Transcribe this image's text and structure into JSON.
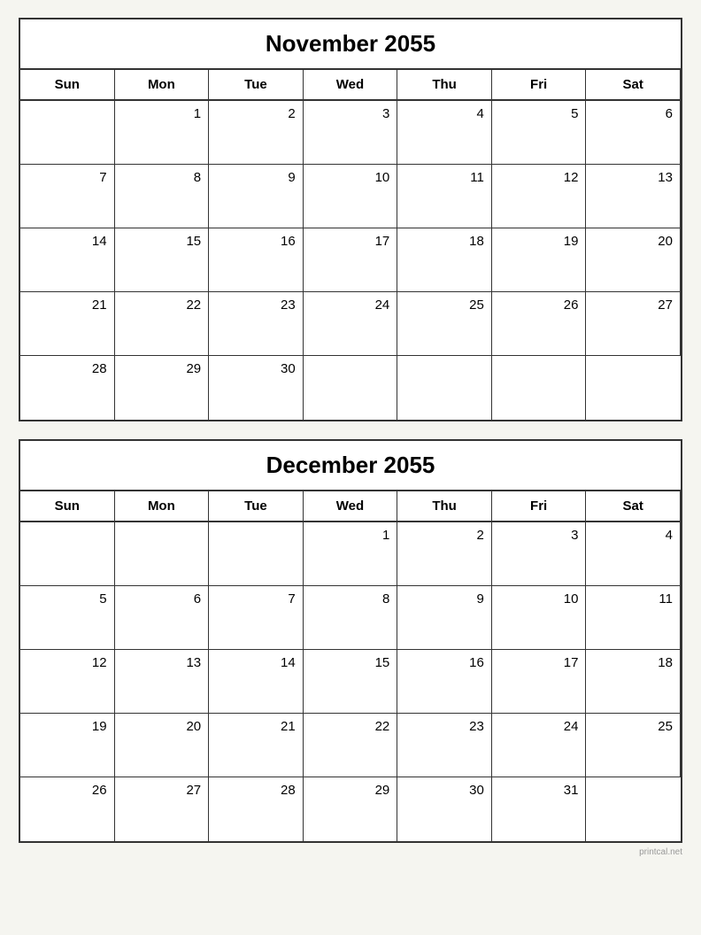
{
  "november": {
    "title": "November 2055",
    "headers": [
      "Sun",
      "Mon",
      "Tue",
      "Wed",
      "Thu",
      "Fri",
      "Sat"
    ],
    "weeks": [
      [
        {
          "day": "",
          "empty": true
        },
        {
          "day": "1"
        },
        {
          "day": "2"
        },
        {
          "day": "3"
        },
        {
          "day": "4"
        },
        {
          "day": "5"
        },
        {
          "day": "6"
        }
      ],
      [
        {
          "day": "7"
        },
        {
          "day": "8"
        },
        {
          "day": "9"
        },
        {
          "day": "10"
        },
        {
          "day": "11"
        },
        {
          "day": "12"
        },
        {
          "day": "13"
        }
      ],
      [
        {
          "day": "14"
        },
        {
          "day": "15"
        },
        {
          "day": "16"
        },
        {
          "day": "17"
        },
        {
          "day": "18"
        },
        {
          "day": "19"
        },
        {
          "day": "20"
        }
      ],
      [
        {
          "day": "21"
        },
        {
          "day": "22"
        },
        {
          "day": "23"
        },
        {
          "day": "24"
        },
        {
          "day": "25"
        },
        {
          "day": "26"
        },
        {
          "day": "27"
        }
      ],
      [
        {
          "day": "28"
        },
        {
          "day": "29"
        },
        {
          "day": "30"
        },
        {
          "day": "",
          "empty": true
        },
        {
          "day": "",
          "empty": true
        },
        {
          "day": "",
          "empty": true
        },
        {
          "day": "",
          "empty": true
        }
      ]
    ]
  },
  "december": {
    "title": "December 2055",
    "headers": [
      "Sun",
      "Mon",
      "Tue",
      "Wed",
      "Thu",
      "Fri",
      "Sat"
    ],
    "weeks": [
      [
        {
          "day": "",
          "empty": true
        },
        {
          "day": "",
          "empty": true
        },
        {
          "day": "",
          "empty": true
        },
        {
          "day": "1"
        },
        {
          "day": "2"
        },
        {
          "day": "3"
        },
        {
          "day": "4"
        }
      ],
      [
        {
          "day": "5"
        },
        {
          "day": "6"
        },
        {
          "day": "7"
        },
        {
          "day": "8"
        },
        {
          "day": "9"
        },
        {
          "day": "10"
        },
        {
          "day": "11"
        }
      ],
      [
        {
          "day": "12"
        },
        {
          "day": "13"
        },
        {
          "day": "14"
        },
        {
          "day": "15"
        },
        {
          "day": "16"
        },
        {
          "day": "17"
        },
        {
          "day": "18"
        }
      ],
      [
        {
          "day": "19"
        },
        {
          "day": "20"
        },
        {
          "day": "21"
        },
        {
          "day": "22"
        },
        {
          "day": "23"
        },
        {
          "day": "24"
        },
        {
          "day": "25"
        }
      ],
      [
        {
          "day": "26"
        },
        {
          "day": "27"
        },
        {
          "day": "28"
        },
        {
          "day": "29"
        },
        {
          "day": "30"
        },
        {
          "day": "31"
        },
        {
          "day": "",
          "empty": true
        }
      ]
    ]
  },
  "watermark": "printcal.net"
}
